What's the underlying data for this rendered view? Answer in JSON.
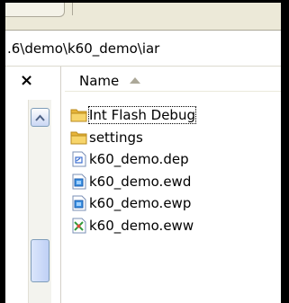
{
  "address_bar": {
    "path": ".6\\demo\\k60_demo\\iar"
  },
  "folders_pane": {
    "close_glyph": "×"
  },
  "file_list": {
    "column_header": "Name",
    "items": [
      {
        "name": "Int Flash Debug",
        "icon": "folder-icon",
        "selected": true
      },
      {
        "name": "settings",
        "icon": "folder-icon"
      },
      {
        "name": "k60_demo.dep",
        "icon": "dep-file-icon"
      },
      {
        "name": "k60_demo.ewd",
        "icon": "ewd-file-icon"
      },
      {
        "name": "k60_demo.ewp",
        "icon": "ewp-file-icon"
      },
      {
        "name": "k60_demo.eww",
        "icon": "eww-workspace-icon"
      }
    ]
  },
  "colors": {
    "folder": "#f2c94c",
    "selection": "#000000",
    "scrollbar": "#7f9db9"
  }
}
